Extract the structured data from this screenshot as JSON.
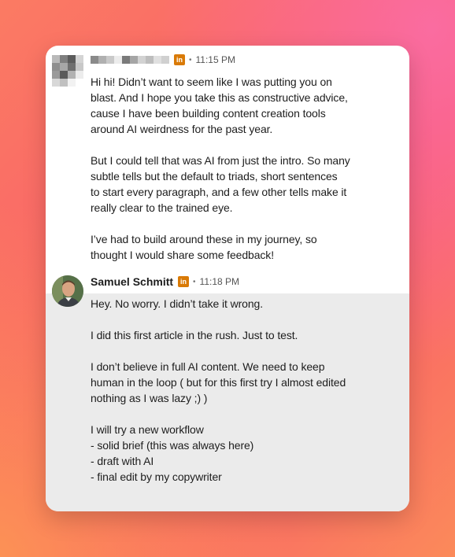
{
  "messages": [
    {
      "sender": "",
      "time": "11:15 PM",
      "paragraphs": [
        [
          "Hi hi! Didn’t want to seem like I was putting you on",
          "blast. And I hope you take this as constructive advice,",
          "cause I have been building content creation tools",
          "around AI weirdness for the past year."
        ],
        [
          "But I could tell that was AI from just the intro. So many",
          "subtle tells but the default to triads, short sentences",
          "to start every paragraph, and a few other tells make it",
          "really clear to the trained eye."
        ],
        [
          "I’ve had to build around these in my journey, so",
          "thought I would share some feedback!"
        ]
      ]
    },
    {
      "sender": "Samuel Schmitt",
      "time": "11:18 PM",
      "paragraphs": [
        [
          "Hey. No worry. I didn’t take it wrong."
        ],
        [
          "I did this first article in the rush. Just to test."
        ],
        [
          "I don’t believe in full AI content. We need to keep",
          "human in the loop ( but for this first try I almost edited",
          "nothing as I was lazy ;) )"
        ],
        [
          "I will try a new workflow",
          "- solid brief (this was always here)",
          "- draft with AI",
          "- final edit by my copywriter"
        ]
      ]
    }
  ],
  "icons": {
    "linkedin": "linkedin-icon",
    "separator": "•"
  },
  "colors": {
    "linkedin_badge": "#d97a06",
    "reply_bg": "#ebebeb"
  }
}
